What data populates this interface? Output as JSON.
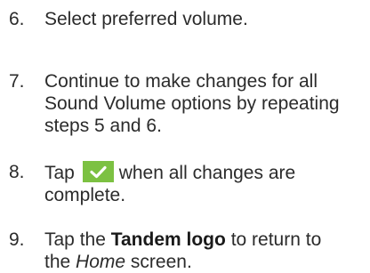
{
  "steps": [
    {
      "number": "6.",
      "line1": "Select preferred volume."
    },
    {
      "number": "7.",
      "line1": "Continue to make changes for all",
      "line2": "Sound Volume options by repeating",
      "line3": "steps 5 and 6."
    },
    {
      "number": "8.",
      "text_before": "Tap",
      "icon": "checkmark-icon",
      "icon_color": "#7cc142",
      "text_after": "when all changes are",
      "line2": "complete."
    },
    {
      "number": "9.",
      "text_before": "Tap the",
      "bold_text": "Tandem logo",
      "text_after": "to return to",
      "line2_before": "the",
      "italic_text": "Home",
      "line2_after": "screen."
    }
  ]
}
